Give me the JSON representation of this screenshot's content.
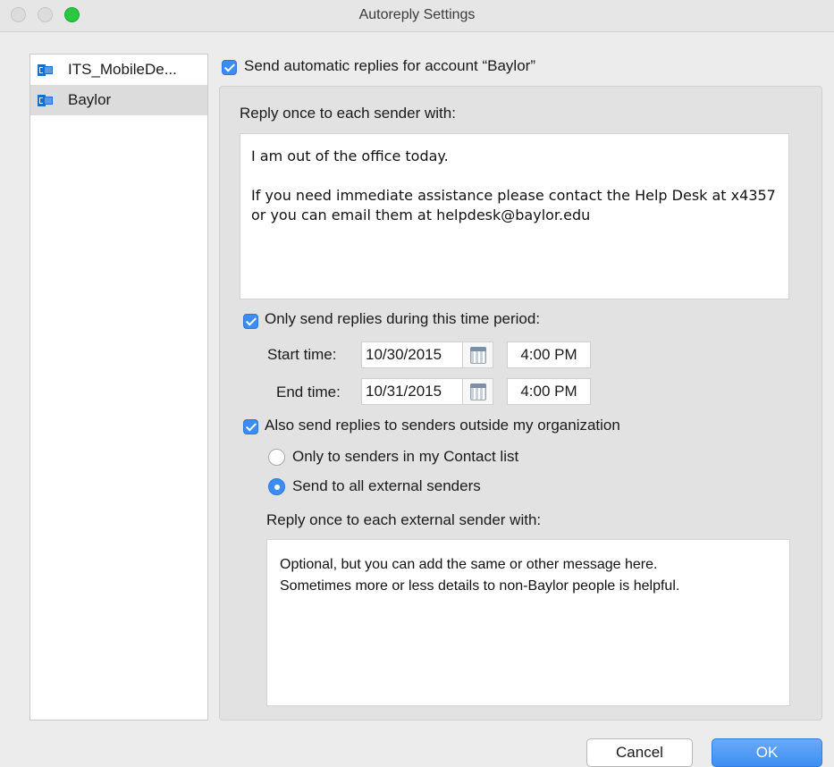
{
  "window": {
    "title": "Autoreply Settings"
  },
  "sidebar": {
    "accounts": [
      {
        "label": "ITS_MobileDe...",
        "selected": false
      },
      {
        "label": "Baylor",
        "selected": true
      }
    ]
  },
  "main": {
    "enable_label": "Send automatic replies for account “Baylor”",
    "enable_checked": true,
    "reply_label": "Reply once to each sender with:",
    "reply_paragraphs": [
      "I am out of the office today.",
      "If you need immediate assistance please contact the Help Desk at x4357 or you can email them at helpdesk@baylor.edu"
    ],
    "time_period_label": "Only send replies during this time period:",
    "time_period_checked": true,
    "start_label": "Start time:",
    "start_date": "10/30/2015",
    "start_time": "4:00 PM",
    "end_label": "End time:",
    "end_date": "10/31/2015",
    "end_time": "4:00 PM",
    "external_label": "Also send replies to senders outside my organization",
    "external_checked": true,
    "radio_contacts_label": "Only to senders in my Contact list",
    "radio_all_label": "Send to all external senders",
    "radio_selected": "all",
    "external_reply_label": "Reply once to each external sender with:",
    "external_reply_lines": [
      "Optional, but you can add the same or other message here.",
      "Sometimes more or less details to non-Baylor people is helpful."
    ]
  },
  "buttons": {
    "cancel": "Cancel",
    "ok": "OK"
  },
  "colors": {
    "accent": "#3b8df5",
    "zoom_button": "#2ac840"
  }
}
